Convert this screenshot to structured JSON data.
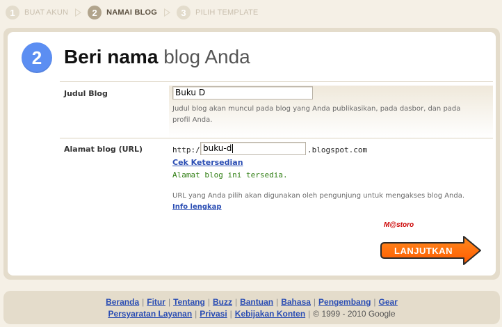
{
  "steps": [
    {
      "num": "1",
      "label": "BUAT AKUN",
      "state": "done"
    },
    {
      "num": "2",
      "label": "NAMAI BLOG",
      "state": "active"
    },
    {
      "num": "3",
      "label": "PILIH TEMPLATE",
      "state": "pending"
    }
  ],
  "header": {
    "step_number": "2",
    "title_strong": "Beri nama",
    "title_light": "blog Anda"
  },
  "form": {
    "blog_title": {
      "label": "Judul Blog",
      "value": "Buku D",
      "help": "Judul blog akan muncul pada blog yang Anda publikasikan, pada dasbor, dan pada profil Anda."
    },
    "blog_address": {
      "label": "Alamat blog (URL)",
      "prefix": "http://",
      "value": "buku-d",
      "suffix": ".blogspot.com",
      "check_link": "Cek Ketersedian",
      "availability": "Alamat blog ini tersedia.",
      "help": "URL yang Anda pilih akan digunakan oleh pengunjung untuk mengakses blog Anda.",
      "info_link": "Info lengkap"
    }
  },
  "watermark": "M@storo",
  "continue_button": "LANJUTKAN",
  "footer": {
    "links_row1": [
      "Beranda",
      "Fitur",
      "Tentang",
      "Buzz",
      "Bantuan",
      "Bahasa",
      "Pengembang",
      "Gear"
    ],
    "links_row2": [
      "Persyaratan Layanan",
      "Privasi",
      "Kebijakan Konten"
    ],
    "copyright": "© 1999 - 2010 Google"
  },
  "colors": {
    "accent_blue": "#5c8ef2",
    "cta_orange": "#ff6a00",
    "link_blue": "#2a4db3",
    "available_green": "#2e7d11",
    "panel_beige": "#e4dccb"
  }
}
